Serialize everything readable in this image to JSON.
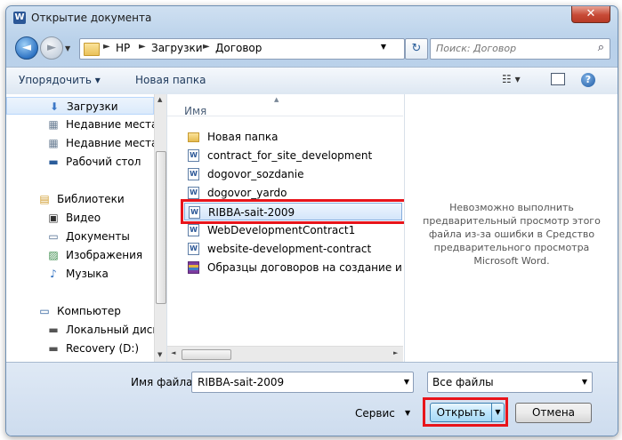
{
  "window": {
    "title": "Открытие документа",
    "app_icon_letter": "W",
    "close_glyph": "✕"
  },
  "nav": {
    "back_glyph": "◄",
    "forward_glyph": "►",
    "breadcrumbs": [
      "HP",
      "Загрузки",
      "Договор"
    ],
    "separator": "►",
    "dropdown_glyph": "▼",
    "refresh_glyph": "↻",
    "search_placeholder": "Поиск: Договор"
  },
  "toolbar": {
    "organize_label": "Упорядочить ▾",
    "new_folder_label": "Новая папка",
    "views_glyph": "☷ ▾",
    "help_glyph": "?"
  },
  "sidebar": {
    "items": [
      {
        "label": "Загрузки",
        "icon": "downloads-icon",
        "glyph": "⬇",
        "color": "#3b77c6",
        "selected": true
      },
      {
        "label": "Недавние места",
        "icon": "recent-places-icon",
        "glyph": "▦",
        "color": "#6b7f95"
      },
      {
        "label": "Недавние места",
        "icon": "recent-places-icon",
        "glyph": "▦",
        "color": "#6b7f95"
      },
      {
        "label": "Рабочий стол",
        "icon": "desktop-icon",
        "glyph": "▬",
        "color": "#2a5c9a"
      },
      {
        "label": "Библиотеки",
        "icon": "libraries-icon",
        "glyph": "▤",
        "color": "#d09b2c"
      },
      {
        "label": "Видео",
        "icon": "video-icon",
        "glyph": "▣",
        "color": "#333333"
      },
      {
        "label": "Документы",
        "icon": "documents-icon",
        "glyph": "▭",
        "color": "#4c6a8e"
      },
      {
        "label": "Изображения",
        "icon": "pictures-icon",
        "glyph": "▨",
        "color": "#3a8a4a"
      },
      {
        "label": "Музыка",
        "icon": "music-icon",
        "glyph": "♪",
        "color": "#2f6fc0"
      },
      {
        "label": "Компьютер",
        "icon": "computer-icon",
        "glyph": "▭",
        "color": "#2a5c9a"
      },
      {
        "label": "Локальный диск (C",
        "icon": "drive-icon",
        "glyph": "▬",
        "color": "#555555"
      },
      {
        "label": "Recovery (D:)",
        "icon": "drive-icon",
        "glyph": "▬",
        "color": "#555555"
      }
    ]
  },
  "files": {
    "column_header": "Имя",
    "sort_glyph": "▲",
    "items": [
      {
        "name": "Новая папка",
        "type": "folder",
        "icon": "folder-icon"
      },
      {
        "name": "contract_for_site_development",
        "type": "doc",
        "icon": "word-doc-icon"
      },
      {
        "name": "dogovor_sozdanie",
        "type": "doc",
        "icon": "word-doc-icon"
      },
      {
        "name": "dogovor_yardo",
        "type": "doc",
        "icon": "word-doc-icon"
      },
      {
        "name": "RIBBA-sait-2009",
        "type": "doc",
        "icon": "word-doc-icon",
        "selected": true
      },
      {
        "name": "WebDevelopmentContract1",
        "type": "doc",
        "icon": "word-doc-icon"
      },
      {
        "name": "website-development-contract",
        "type": "doc",
        "icon": "word-doc-icon"
      },
      {
        "name": "Образцы договоров на создание и раз...",
        "type": "rar",
        "icon": "archive-icon"
      }
    ]
  },
  "preview": {
    "message": "Невозможно выполнить предварительный просмотр этого файла из-за ошибки в Средство предварительного просмотра Microsoft Word."
  },
  "bottom": {
    "filename_label": "Имя файла:",
    "filename_value": "RIBBA-sait-2009",
    "filetype_value": "Все файлы",
    "service_label": "Сервис",
    "open_label": "Открыть",
    "cancel_label": "Отмена",
    "dropdown_glyph": "▼"
  },
  "colors": {
    "highlight": "#e8141b",
    "accent": "#3c7fb1"
  }
}
